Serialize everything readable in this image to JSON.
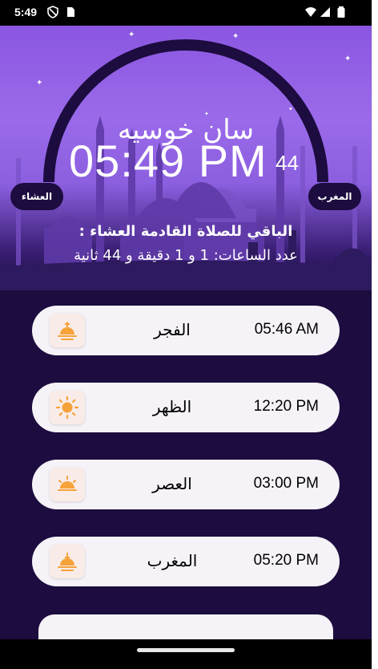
{
  "status_bar": {
    "time": "5:49"
  },
  "header": {
    "city": "سان خوسيه",
    "time": "05:49 PM",
    "seconds": "44",
    "prev_prayer": "المغرب",
    "next_prayer": "العشاء",
    "remaining_title": "الباقي للصلاة القادمة العشاء :",
    "remaining_detail": "عدد الساعات: 1 و 1 دقيقة و 44 ثانية"
  },
  "prayers": [
    {
      "name": "الفجر",
      "time": "05:46 AM",
      "icon": "sunrise-icon"
    },
    {
      "name": "الظهر",
      "time": "12:20 PM",
      "icon": "sun-icon"
    },
    {
      "name": "العصر",
      "time": "03:00 PM",
      "icon": "sun-half-icon"
    },
    {
      "name": "المغرب",
      "time": "05:20 PM",
      "icon": "sunset-icon"
    }
  ],
  "colors": {
    "background": "#1c0c3f",
    "hero_top": "#8a56e0",
    "card": "#f6f3f8",
    "icon_orange": "#f6a23a"
  }
}
